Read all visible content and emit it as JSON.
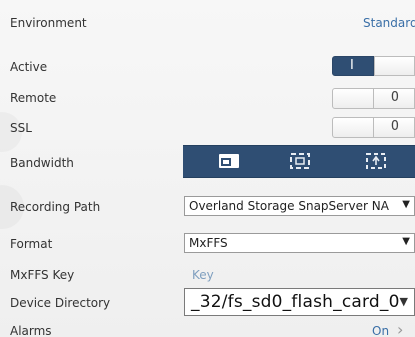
{
  "settings": {
    "environment": {
      "label": "Environment",
      "value": "Standard"
    },
    "active": {
      "label": "Active",
      "toggle_on": "I"
    },
    "remote": {
      "label": "Remote",
      "toggle_off": "O"
    },
    "ssl": {
      "label": "SSL",
      "toggle_off": "O"
    },
    "bandwidth": {
      "label": "Bandwidth",
      "options": [
        "window-icon",
        "fullscreen-frame-icon",
        "bandwidth-icon"
      ],
      "selected_index": 0
    },
    "recording_path": {
      "label": "Recording Path",
      "value": "Overland Storage SnapServer NA"
    },
    "format": {
      "label": "Format",
      "value": "MxFFS"
    },
    "mxffs_key": {
      "label": "MxFFS Key",
      "value": "Key"
    },
    "device_directory": {
      "label": "Device Directory",
      "value": "_32/fs_sd0_flash_card_0"
    },
    "alarms": {
      "label": "Alarms",
      "value": "On",
      "chevron": "›"
    }
  },
  "colors": {
    "accent": "#2f4e73",
    "link": "#3a6fa7",
    "background": "#f4f4f4"
  }
}
